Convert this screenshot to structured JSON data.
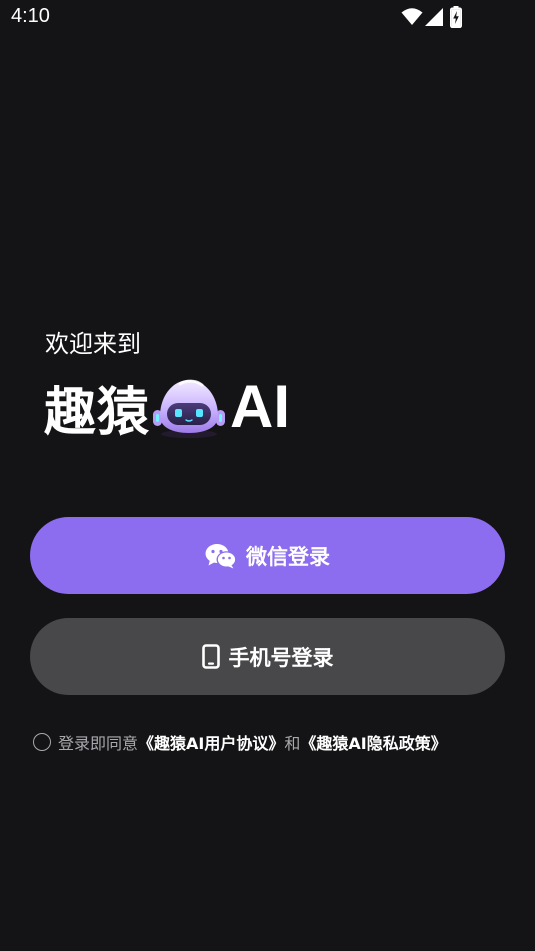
{
  "status_bar": {
    "time": "4:10",
    "icons": [
      "wifi-icon",
      "cellular-signal-icon",
      "battery-charging-icon"
    ]
  },
  "welcome": {
    "greeting": "欢迎来到",
    "brand_name": "趣猿",
    "brand_suffix": "AI",
    "mascot": "robot-mascot-icon"
  },
  "buttons": {
    "wechat_login": {
      "label": "微信登录",
      "icon": "wechat-icon",
      "color": "#8c6cef"
    },
    "phone_login": {
      "label": "手机号登录",
      "icon": "mobile-phone-icon",
      "color": "#48484b"
    }
  },
  "agreement": {
    "prefix": "登录即同意",
    "user_agreement": "《趣猿AI用户协议》",
    "conjunction": "和",
    "privacy_policy": "《趣猿AI隐私政策》",
    "checked": false
  },
  "colors": {
    "background": "#141315",
    "accent": "#8c6cef",
    "secondary_button": "#48484b",
    "muted_text": "#a9a8ad"
  }
}
